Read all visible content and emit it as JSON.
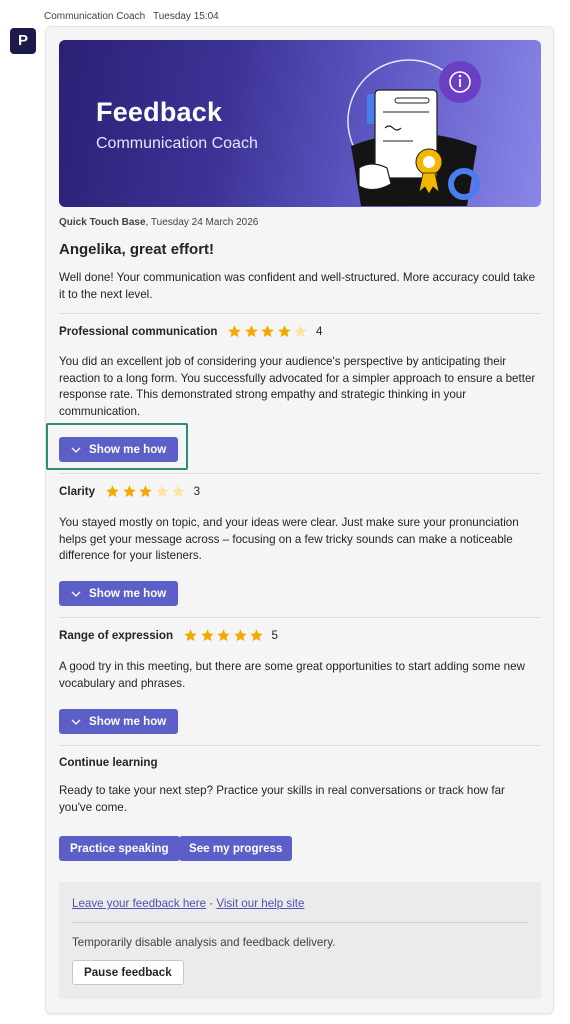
{
  "message": {
    "sender": "Communication Coach",
    "time": "Tuesday 15:04",
    "avatar_letter": "P"
  },
  "banner": {
    "title": "Feedback",
    "subtitle": "Communication Coach"
  },
  "session": {
    "name": "Quick Touch Base",
    "date": ", Tuesday 24 March 2026"
  },
  "greeting": "Angelika, great effort!",
  "summary": "Well done! Your communication was confident and well-structured. More accuracy could take it to the next level.",
  "skills": [
    {
      "name": "Professional communication",
      "rating": 4,
      "max_rating": 5,
      "score_label": "4",
      "text": "You did an excellent job of considering your audience's perspective by anticipating their reaction to a long form. You successfully advocated for a simpler approach to ensure a better response rate. This demonstrated strong empathy and strategic thinking in your communication.",
      "button_label": "Show me how"
    },
    {
      "name": "Clarity",
      "rating": 3,
      "max_rating": 5,
      "score_label": "3",
      "text": "You stayed mostly on topic, and your ideas were clear. Just make sure your pronunciation helps get your message across – focusing on a few tricky sounds can make a noticeable difference for your listeners.",
      "button_label": "Show me how"
    },
    {
      "name": "Range of expression",
      "rating": 5,
      "max_rating": 5,
      "score_label": "5",
      "text": "A good try in this meeting, but there are some great opportunities to start adding some new vocabulary and phrases.",
      "button_label": "Show me how"
    }
  ],
  "continue_learning": {
    "heading": "Continue learning",
    "text": "Ready to take your next step? Practice your skills in real conversations or track how far you've come.",
    "practice_label": "Practice speaking",
    "progress_label": "See my progress"
  },
  "footer": {
    "feedback_link": "Leave your feedback here",
    "separator": " · ",
    "help_link": "Visit our help site",
    "disable_text": "Temporarily disable analysis and feedback delivery.",
    "pause_label": "Pause feedback"
  },
  "colors": {
    "accent": "#5b5fc7",
    "star_filled": "#f2a900",
    "star_empty": "#fbe3a6",
    "highlight": "#2e8b7a",
    "banner_dark": "#2b2075",
    "banner_light": "#8a86e8"
  },
  "icons": {
    "chevron": "chevron-down-icon",
    "star": "star-icon",
    "info": "info-icon"
  }
}
